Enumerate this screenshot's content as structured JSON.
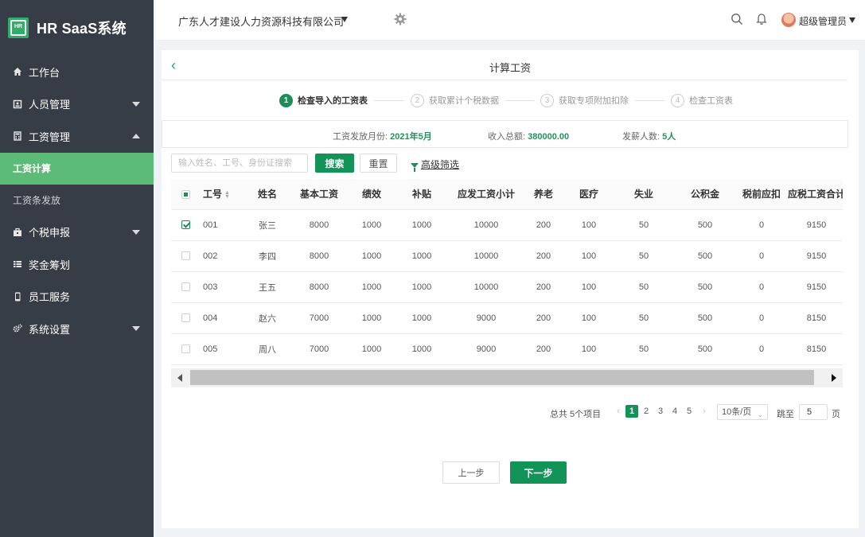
{
  "app": {
    "logo_mark": "HR",
    "title": "HR SaaS系统"
  },
  "sidebar": {
    "items": [
      {
        "label": "工作台",
        "icon": "home-icon"
      },
      {
        "label": "人员管理",
        "icon": "id-card-icon"
      },
      {
        "label": "工资管理",
        "icon": "calculator-icon"
      },
      {
        "label": "工资计算",
        "icon": ""
      },
      {
        "label": "工资条发放",
        "icon": ""
      },
      {
        "label": "个税申报",
        "icon": "briefcase-icon"
      },
      {
        "label": "奖金筹划",
        "icon": "list-icon"
      },
      {
        "label": "员工服务",
        "icon": "mobile-icon"
      },
      {
        "label": "系统设置",
        "icon": "cogs-icon"
      }
    ]
  },
  "topbar": {
    "company": "广东人才建设人力资源科技有限公司",
    "username": "超级管理员"
  },
  "page": {
    "title": "计算工资"
  },
  "steps": [
    {
      "num": "1",
      "label": "检查导入的工资表"
    },
    {
      "num": "2",
      "label": "获取累计个税数据"
    },
    {
      "num": "3",
      "label": "获取专项附加扣除"
    },
    {
      "num": "4",
      "label": "检查工资表"
    }
  ],
  "summary": {
    "month_label": "工资发放月份:",
    "month_value": "2021年5月",
    "income_label": "收入总额:",
    "income_value": "380000.00",
    "count_label": "发薪人数:",
    "count_value": "5人"
  },
  "filters": {
    "search_placeholder": "输入姓名、工号、身份证搜索",
    "search_label": "搜索",
    "reset_label": "重置",
    "advanced_label": "高级筛选"
  },
  "table": {
    "columns": [
      "工号",
      "姓名",
      "基本工资",
      "绩效",
      "补贴",
      "应发工资小计",
      "养老",
      "医疗",
      "失业",
      "公积金",
      "税前应扣",
      "应税工资合计"
    ],
    "rows": [
      {
        "checked": true,
        "cells": [
          "001",
          "张三",
          "8000",
          "1000",
          "1000",
          "10000",
          "200",
          "100",
          "50",
          "500",
          "0",
          "9150"
        ]
      },
      {
        "checked": false,
        "cells": [
          "002",
          "李四",
          "8000",
          "1000",
          "1000",
          "10000",
          "200",
          "100",
          "50",
          "500",
          "0",
          "9150"
        ]
      },
      {
        "checked": false,
        "cells": [
          "003",
          "王五",
          "8000",
          "1000",
          "1000",
          "10000",
          "200",
          "100",
          "50",
          "500",
          "0",
          "9150"
        ]
      },
      {
        "checked": false,
        "cells": [
          "004",
          "赵六",
          "7000",
          "1000",
          "1000",
          "9000",
          "200",
          "100",
          "50",
          "500",
          "0",
          "8150"
        ]
      },
      {
        "checked": false,
        "cells": [
          "005",
          "周八",
          "7000",
          "1000",
          "1000",
          "9000",
          "200",
          "100",
          "50",
          "500",
          "0",
          "8150"
        ]
      }
    ]
  },
  "pagination": {
    "total": "总共 5个项目",
    "pages": [
      "1",
      "2",
      "3",
      "4",
      "5"
    ],
    "current": "1",
    "page_size": "10条/页",
    "jump_label": "跳至",
    "jump_value": "5",
    "jump_unit": "页"
  },
  "actions": {
    "prev_label": "上一步",
    "next_label": "下一步"
  },
  "colors": {
    "primary": "#129358",
    "sidebar_bg": "#373d47",
    "sidebar_active": "#5dbb78"
  }
}
